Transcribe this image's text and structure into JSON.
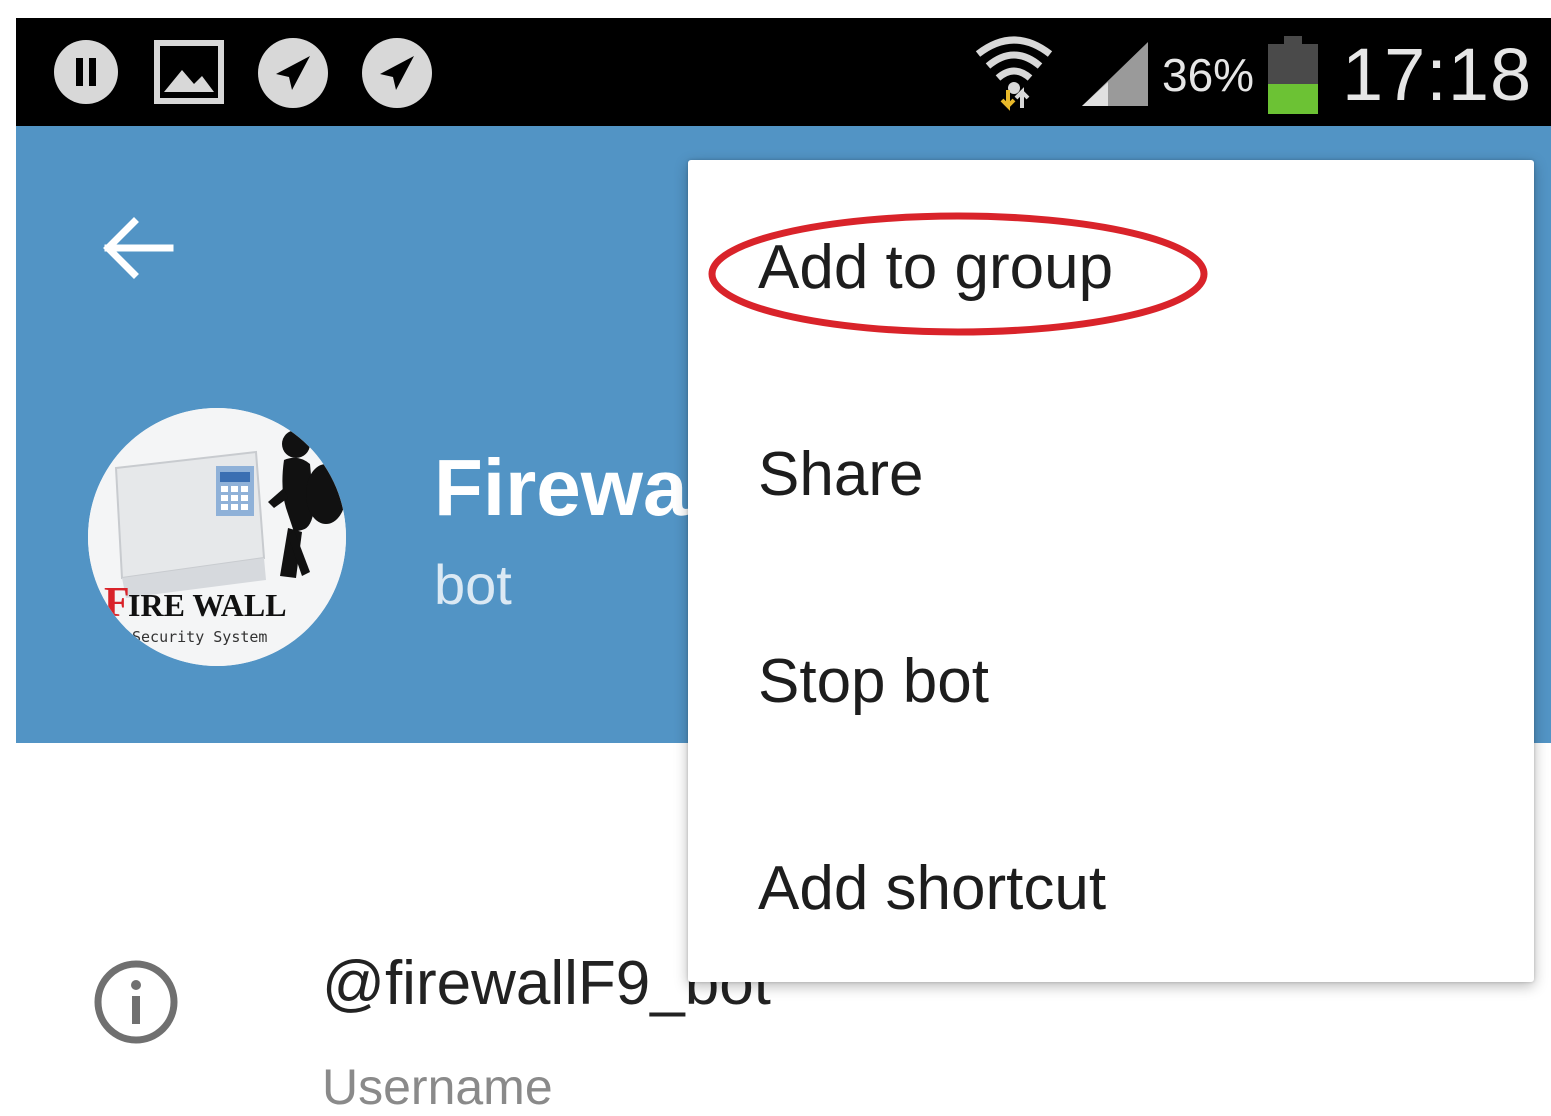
{
  "status_bar": {
    "icons": [
      "pause-icon",
      "image-icon",
      "telegram-icon",
      "telegram-icon",
      "wifi-icon",
      "signal-icon",
      "battery-icon"
    ],
    "battery_percent": "36%",
    "time": "17:18"
  },
  "header": {
    "back_icon": "arrow-left-icon",
    "profile_name": "Firewa",
    "profile_status": "bot",
    "avatar_logo_text": "FIRE WALL",
    "avatar_logo_subtext": "Security System",
    "background_color": "#5294c5"
  },
  "menu": {
    "items": [
      {
        "label": "Add to group",
        "highlighted": true
      },
      {
        "label": "Share"
      },
      {
        "label": "Stop bot"
      },
      {
        "label": "Add shortcut"
      }
    ],
    "highlight_color": "#d9232a"
  },
  "info": {
    "icon": "info-icon",
    "value": "@firewallF9_bot",
    "label": "Username"
  }
}
